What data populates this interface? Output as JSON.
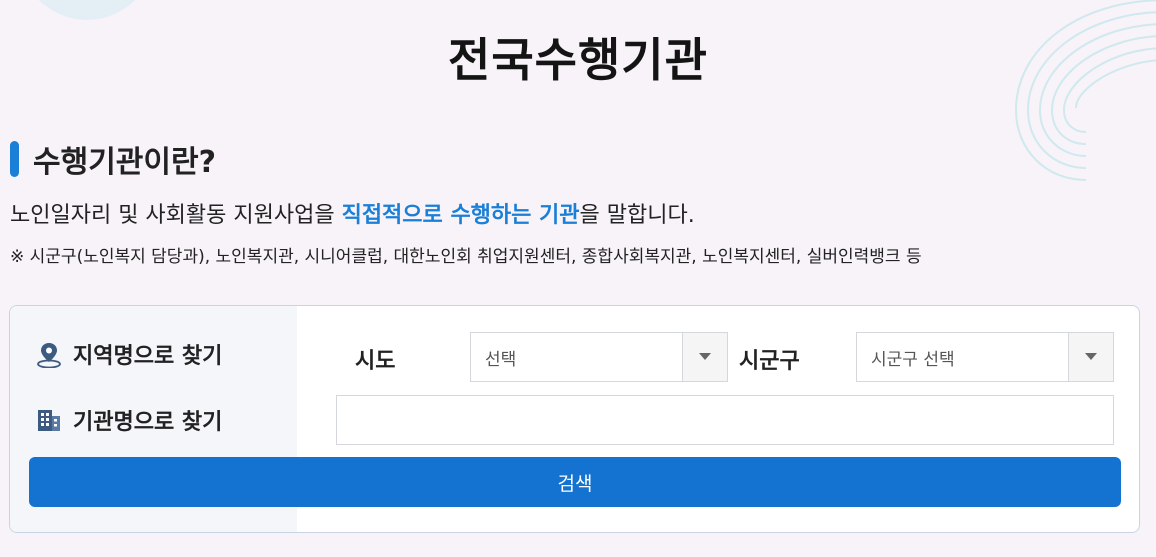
{
  "page": {
    "title": "전국수행기관"
  },
  "section": {
    "heading": "수행기관이란?",
    "desc_before": "노인일자리 및 사회활동 지원사업을 ",
    "desc_highlight": "직접적으로 수행하는 기관",
    "desc_after": "을 말합니다.",
    "note": "※ 시군구(노인복지 담당과), 노인복지관, 시니어클럽, 대한노인회 취업지원센터, 종합사회복지관, 노인복지센터, 실버인력뱅크 등"
  },
  "search": {
    "mode_region": "지역명으로 찾기",
    "mode_name": "기관명으로 찾기",
    "sido_label": "시도",
    "sido_value": "선택",
    "sigungu_label": "시군구",
    "sigungu_value": "시군구 선택",
    "name_input_value": "",
    "search_button": "검색"
  },
  "colors": {
    "accent": "#1a7fd6",
    "button": "#1472d1",
    "background": "#f7f3f9"
  },
  "icons": {
    "region": "location-pin-icon",
    "name": "building-icon",
    "dropdown": "chevron-down-icon"
  }
}
